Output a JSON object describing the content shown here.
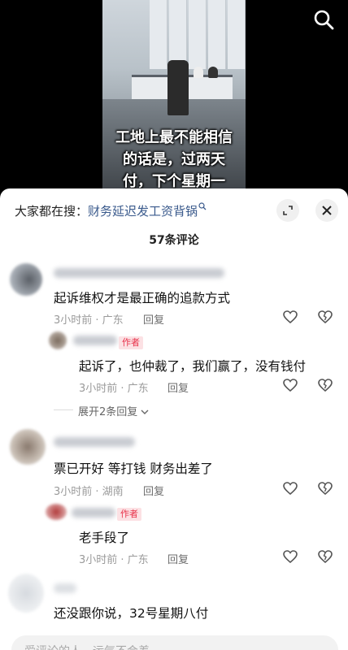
{
  "video": {
    "caption_lines": [
      "工地上最不能相信",
      "的话是，过两天",
      "付，下个星期一"
    ],
    "icon": "search-icon"
  },
  "sheet": {
    "search_prefix": "大家都在搜：",
    "search_keyword": "财务延迟发工资背锅",
    "comment_count": "57条评论",
    "icons": {
      "expand": "expand-icon",
      "close": "close-icon"
    }
  },
  "comments": [
    {
      "text": "起诉维权才是最正确的追款方式",
      "meta": "3小时前 · 广东",
      "reply": "回复"
    },
    {
      "text": "起诉了，也仲裁了，我们赢了，没有钱付",
      "meta": "3小时前 · 广东",
      "reply": "回复",
      "tag": "作者"
    },
    {
      "text": "展开2条回复"
    },
    {
      "text": "票已开好 等打钱 财务出差了",
      "meta": "3小时前 · 湖南",
      "reply": "回复"
    },
    {
      "text": "老手段了",
      "meta": "3小时前 · 广东",
      "reply": "回复",
      "tag": "作者"
    },
    {
      "text": "还没跟你说，32号星期八付"
    }
  ],
  "input": {
    "placeholder": "爱评论的人，运气不会差"
  },
  "colors": {
    "accent_link": "#3a5a8c",
    "author_tag_bg": "#fce1e4",
    "author_tag_text": "#e8334b"
  }
}
